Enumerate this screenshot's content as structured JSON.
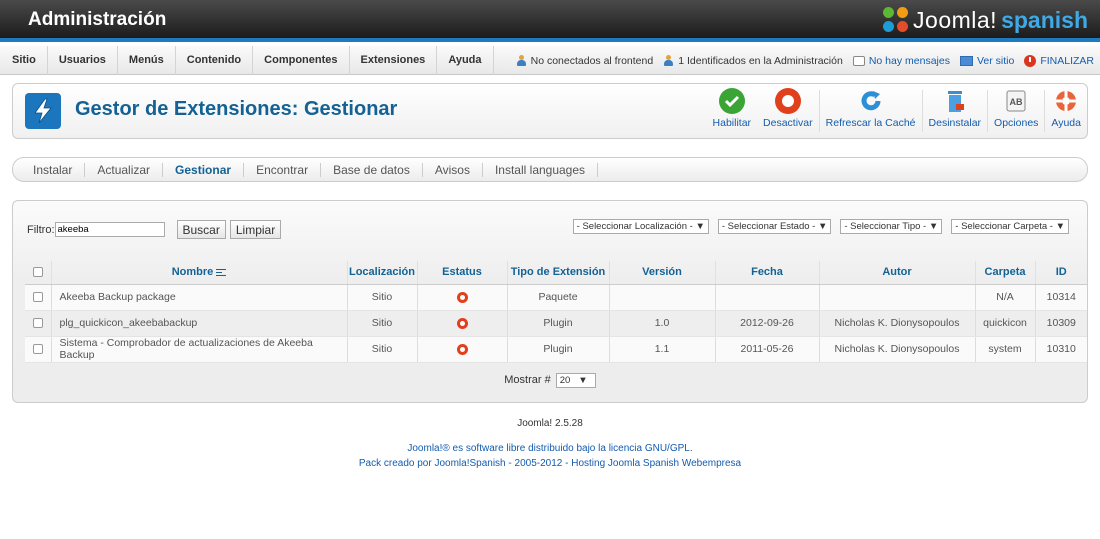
{
  "header": {
    "title": "Administración",
    "logo_word": "Joomla!",
    "logo_word2": "spanish"
  },
  "menu": {
    "items": [
      "Sitio",
      "Usuarios",
      "Menús",
      "Contenido",
      "Componentes",
      "Extensiones",
      "Ayuda"
    ]
  },
  "status": {
    "frontend": "No conectados al frontend",
    "admin": "1 Identificados en la Administración",
    "messages": "No hay mensajes",
    "view_site": "Ver sitio",
    "logout": "FINALIZAR"
  },
  "toolbar": {
    "page_title": "Gestor de Extensiones: Gestionar",
    "enable": "Habilitar",
    "disable": "Desactivar",
    "refresh": "Refrescar la Caché",
    "uninstall": "Desinstalar",
    "options": "Opciones",
    "help": "Ayuda",
    "options_glyph": "AB"
  },
  "subtabs": [
    "Instalar",
    "Actualizar",
    "Gestionar",
    "Encontrar",
    "Base de datos",
    "Avisos",
    "Install languages"
  ],
  "filter": {
    "label": "Filtro:",
    "value": "akeeba",
    "search_btn": "Buscar",
    "clear_btn": "Limpiar"
  },
  "selects": {
    "location": "- Seleccionar Localización -",
    "state": "- Seleccionar Estado -",
    "type": "- Seleccionar Tipo -",
    "folder": "- Seleccionar Carpeta -",
    "arrow": "▼"
  },
  "table": {
    "headers": {
      "name": "Nombre",
      "location": "Localización",
      "status": "Estatus",
      "type": "Tipo de Extensión",
      "version": "Versión",
      "date": "Fecha",
      "author": "Autor",
      "folder": "Carpeta",
      "id": "ID"
    },
    "rows": [
      {
        "name": "Akeeba Backup package",
        "location": "Sitio",
        "type": "Paquete",
        "version": "",
        "date": "",
        "author": "",
        "folder": "N/A",
        "id": "10314"
      },
      {
        "name": "plg_quickicon_akeebabackup",
        "location": "Sitio",
        "type": "Plugin",
        "version": "1.0",
        "date": "2012-09-26",
        "author": "Nicholas K. Dionysopoulos",
        "folder": "quickicon",
        "id": "10309"
      },
      {
        "name": "Sistema - Comprobador de actualizaciones de Akeeba Backup",
        "location": "Sitio",
        "type": "Plugin",
        "version": "1.1",
        "date": "2011-05-26",
        "author": "Nicholas K. Dionysopoulos",
        "folder": "system",
        "id": "10310"
      }
    ]
  },
  "pager": {
    "label": "Mostrar #",
    "value": "20"
  },
  "footer": {
    "version": "Joomla! 2.5.28",
    "license": "Joomla!® es software libre distribuido bajo la licencia GNU/GPL.",
    "credits": "Pack creado por Joomla!Spanish - 2005-2012 - Hosting Joomla Spanish Webempresa"
  },
  "colors": {
    "accent": "#146295",
    "link": "#135cae",
    "header_bar": "#1f7ac0",
    "status_off": "#e0401c"
  }
}
